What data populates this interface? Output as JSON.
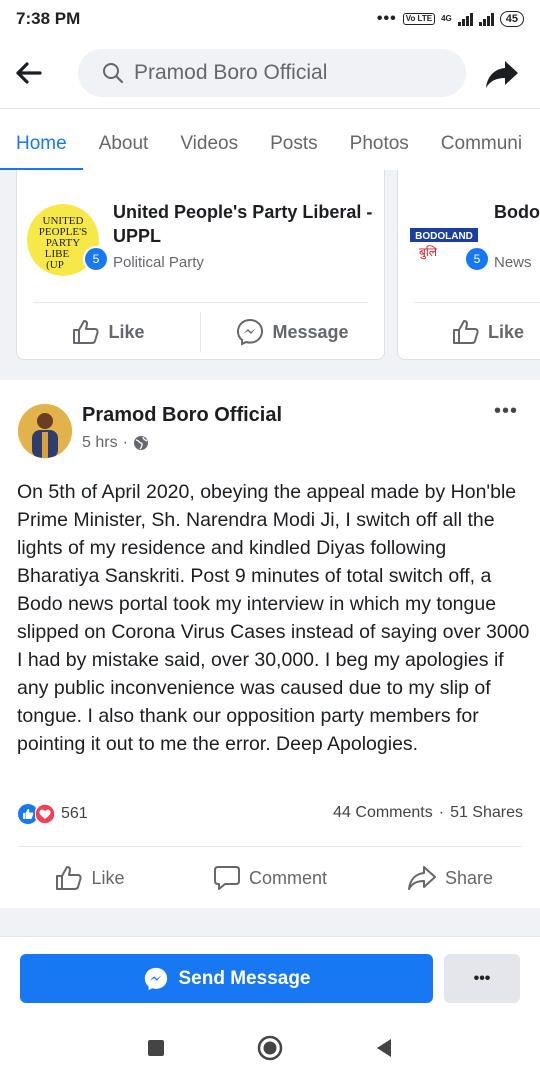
{
  "status_bar": {
    "time": "7:38 PM",
    "network": "4G",
    "volte": "Vo LTE",
    "battery": "45"
  },
  "search": {
    "query": "Pramod Boro Official"
  },
  "tabs": [
    {
      "label": "Home",
      "active": true
    },
    {
      "label": "About",
      "active": false
    },
    {
      "label": "Videos",
      "active": false
    },
    {
      "label": "Posts",
      "active": false
    },
    {
      "label": "Photos",
      "active": false
    },
    {
      "label": "Communi",
      "active": false
    }
  ],
  "related_pages": [
    {
      "title": "United People's Party Liberal -UPPL",
      "category": "Political Party",
      "badge": "5",
      "logo_text": [
        "UNITED",
        "PEOPLE'S",
        "PARTY",
        "LIBE",
        "(UP"
      ],
      "like_label": "Like",
      "message_label": "Message"
    },
    {
      "title": "Bodol",
      "category": "News",
      "badge": "5",
      "logo_text": [
        "BODOLAND",
        "बुलि"
      ],
      "like_label": "Like"
    }
  ],
  "post": {
    "author": "Pramod Boro Official",
    "time": "5 hrs",
    "separator": "·",
    "more": "•••",
    "body": "On 5th of April 2020, obeying  the appeal made by Hon'ble Prime Minister, Sh. Narendra Modi Ji, I switch off all the lights of my residence and kindled Diyas following Bharatiya Sanskriti. Post 9 minutes of total switch off, a Bodo news portal took my interview in which my tongue slipped on Corona Virus Cases instead of saying over 3000 I had by mistake said, over 30,000. I beg my apologies if any public  inconvenience was caused due to my slip of tongue. I also thank our opposition party members for pointing it out to me the error. Deep Apologies.",
    "reaction_count": "561",
    "comments": "44 Comments",
    "dot": "·",
    "shares": "51 Shares",
    "actions": {
      "like": "Like",
      "comment": "Comment",
      "share": "Share"
    }
  },
  "cta": {
    "send_message": "Send Message",
    "more": "•••"
  },
  "colors": {
    "brand": "#1877f2",
    "text": "#1c1e21",
    "muted": "#65676b",
    "background": "#f0f2f5",
    "love": "#f33e58"
  },
  "icons": {
    "back": "arrow-left-icon",
    "search": "search-icon",
    "share": "share-arrow-icon",
    "like": "thumbs-up-icon",
    "messenger": "messenger-icon",
    "comment": "comment-icon",
    "globe": "globe-icon"
  }
}
